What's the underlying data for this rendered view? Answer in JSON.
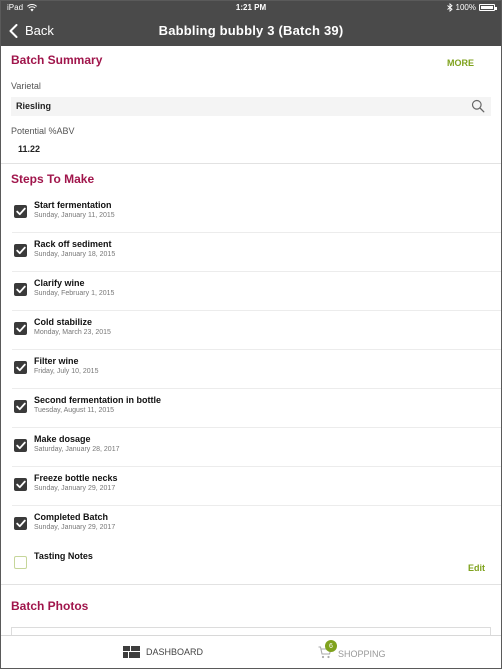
{
  "status_bar": {
    "device": "iPad",
    "time": "1:21 PM",
    "battery": "100%"
  },
  "nav": {
    "back_label": "Back",
    "title": "Babbling bubbly 3 (Batch 39)"
  },
  "summary": {
    "title": "Batch Summary",
    "more_label": "MORE",
    "varietal_label": "Varietal",
    "varietal_value": "Riesling",
    "abv_label": "Potential %ABV",
    "abv_value": "11.22"
  },
  "steps": {
    "title": "Steps To Make",
    "items": [
      {
        "name": "Start fermentation",
        "date": "Sunday, January 11, 2015",
        "checked": true
      },
      {
        "name": "Rack off sediment",
        "date": "Sunday, January 18, 2015",
        "checked": true
      },
      {
        "name": "Clarify wine",
        "date": "Sunday, February 1, 2015",
        "checked": true
      },
      {
        "name": "Cold stabilize",
        "date": "Monday, March 23, 2015",
        "checked": true
      },
      {
        "name": "Filter wine",
        "date": "Friday, July 10, 2015",
        "checked": true
      },
      {
        "name": "Second fermentation in bottle",
        "date": "Tuesday, August 11, 2015",
        "checked": true
      },
      {
        "name": "Make dosage",
        "date": "Saturday, January 28, 2017",
        "checked": true
      },
      {
        "name": "Freeze bottle necks",
        "date": "Sunday, January 29, 2017",
        "checked": true
      },
      {
        "name": "Completed Batch",
        "date": "Sunday, January 29, 2017",
        "checked": true
      }
    ],
    "tasting_notes": {
      "name": "Tasting Notes",
      "edit_label": "Edit",
      "checked": false
    }
  },
  "photos": {
    "title": "Batch Photos"
  },
  "tab_bar": {
    "dashboard_label": "DASHBOARD",
    "shopping_label": "SHOPPING",
    "shopping_badge": "6"
  },
  "colors": {
    "accent_red": "#a0154b",
    "accent_green": "#7fa21d",
    "bar_dark": "#4a4a4a"
  }
}
